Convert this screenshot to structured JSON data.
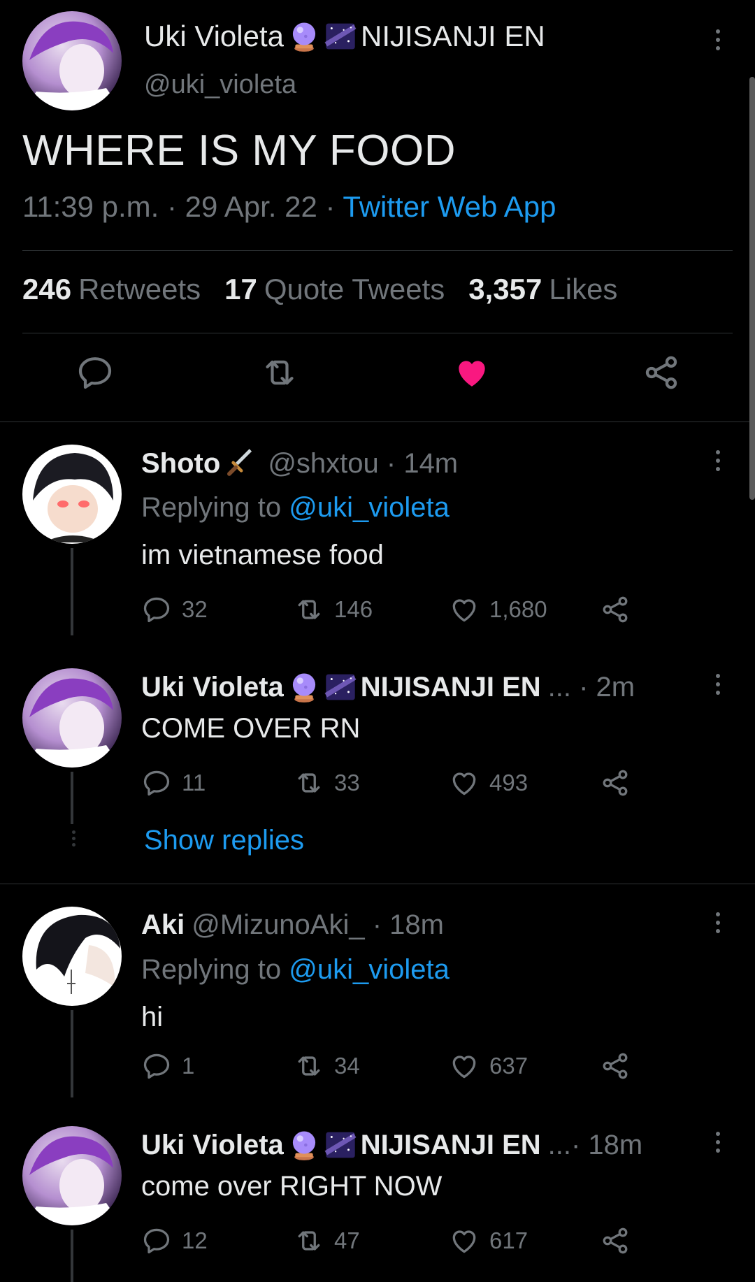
{
  "main_tweet": {
    "name": "Uki Violeta",
    "org": "NIJISANJI EN",
    "handle": "@uki_violeta",
    "text": "WHERE IS MY FOOD",
    "time": "11:39 p.m. · 29 Apr. 22 · ",
    "app": "Twitter Web App",
    "retweets_count": "246",
    "retweets_label": "Retweets",
    "quotes_count": "17",
    "quotes_label": "Quote Tweets",
    "likes_count": "3,357",
    "likes_label": "Likes",
    "liked": true
  },
  "replies": [
    {
      "name": "Shoto",
      "handle": "@shxtou · 14m",
      "replying_prefix": "Replying to ",
      "replying_to": "@uki_violeta",
      "text": "im vietnamese food",
      "comments": "32",
      "retweets": "146",
      "likes": "1,680"
    },
    {
      "name": "Uki Violeta",
      "org": "NIJISANJI EN",
      "handle": "... · 2m",
      "text": "COME OVER RN",
      "comments": "11",
      "retweets": "33",
      "likes": "493",
      "show_replies": "Show replies"
    },
    {
      "name": "Aki",
      "handle": "@MizunoAki_ · 18m",
      "replying_prefix": "Replying to ",
      "replying_to": "@uki_violeta",
      "text": "hi",
      "comments": "1",
      "retweets": "34",
      "likes": "637"
    },
    {
      "name": "Uki Violeta",
      "org": "NIJISANJI EN",
      "handle": "...· 18m",
      "text": "come over RIGHT NOW",
      "comments": "12",
      "retweets": "47",
      "likes": "617"
    }
  ],
  "colors": {
    "background": "#000000",
    "accent": "#1d9bf0",
    "like": "#f91880",
    "muted": "#71767b"
  },
  "icons": [
    "crystal-ball-icon",
    "night-sky-icon",
    "dagger-icon",
    "comment-icon",
    "retweet-icon",
    "heart-icon",
    "share-icon",
    "more-icon"
  ]
}
